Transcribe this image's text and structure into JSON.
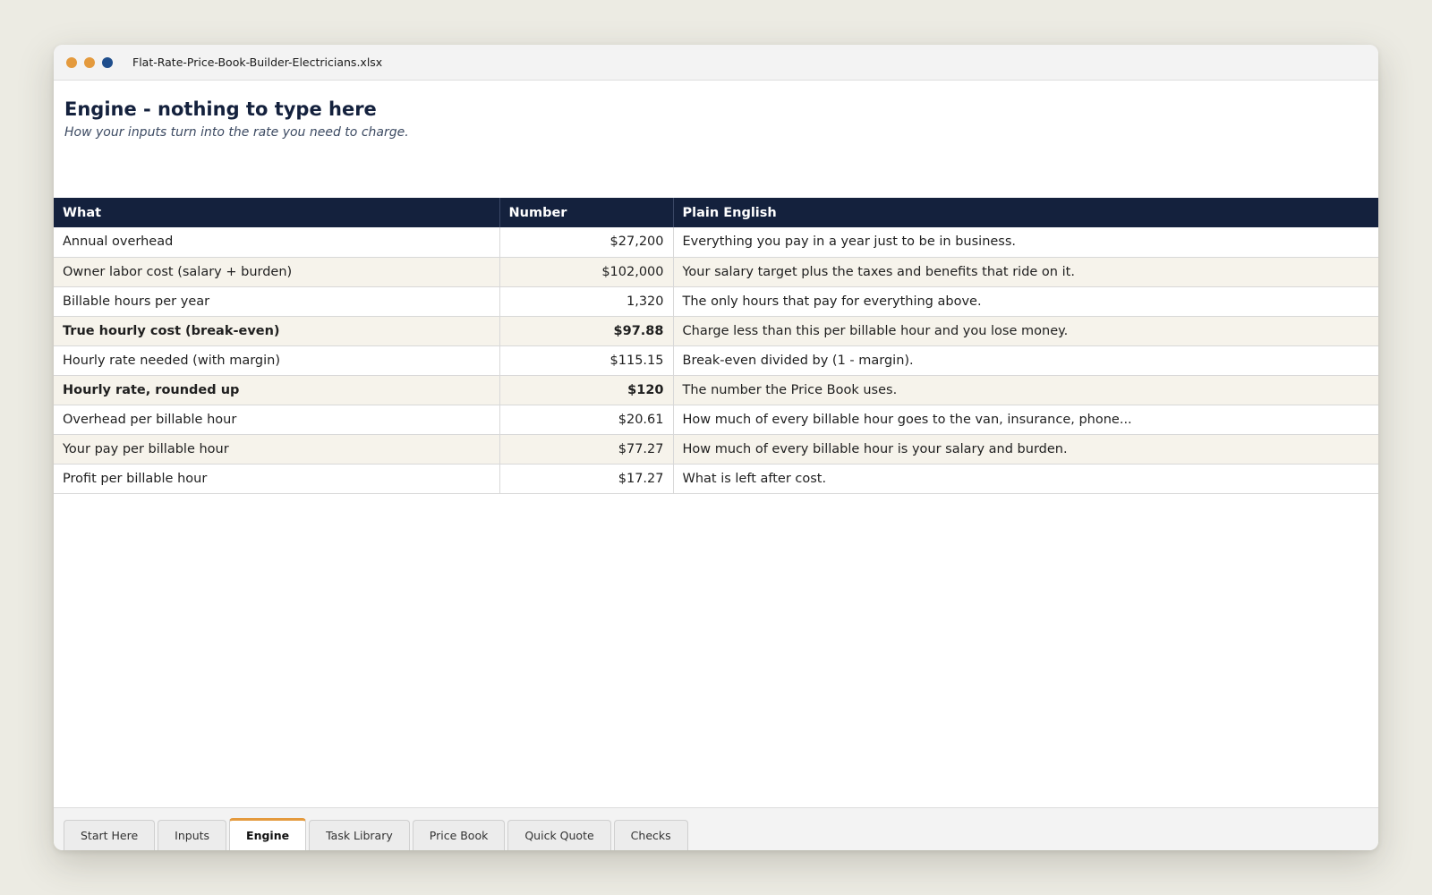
{
  "window": {
    "filename": "Flat-Rate-Price-Book-Builder-Electricians.xlsx",
    "controls": [
      {
        "name": "close",
        "color": "#e49a3d"
      },
      {
        "name": "minimize",
        "color": "#e49a3d"
      },
      {
        "name": "maximize",
        "color": "#1f4e8c"
      }
    ]
  },
  "sheet": {
    "title": "Engine - nothing to type here",
    "subtitle": "How your inputs turn into the rate you need to charge.",
    "columns": [
      "What",
      "Number",
      "Plain English"
    ],
    "rows": [
      {
        "what": "Annual overhead",
        "number": "$27,200",
        "plain": "Everything you pay in a year just to be in business.",
        "bold": false
      },
      {
        "what": "Owner labor cost (salary + burden)",
        "number": "$102,000",
        "plain": "Your salary target plus the taxes and benefits that ride on it.",
        "bold": false
      },
      {
        "what": "Billable hours per year",
        "number": "1,320",
        "plain": "The only hours that pay for everything above.",
        "bold": false
      },
      {
        "what": "True hourly cost (break-even)",
        "number": "$97.88",
        "plain": "Charge less than this per billable hour and you lose money.",
        "bold": true
      },
      {
        "what": "Hourly rate needed (with margin)",
        "number": "$115.15",
        "plain": "Break-even divided by (1 - margin).",
        "bold": false
      },
      {
        "what": "Hourly rate, rounded up",
        "number": "$120",
        "plain": "The number the Price Book uses.",
        "bold": true
      },
      {
        "what": "Overhead per billable hour",
        "number": "$20.61",
        "plain": "How much of every billable hour goes to the van, insurance, phone...",
        "bold": false
      },
      {
        "what": "Your pay per billable hour",
        "number": "$77.27",
        "plain": "How much of every billable hour is your salary and burden.",
        "bold": false
      },
      {
        "what": "Profit per billable hour",
        "number": "$17.27",
        "plain": "What is left after cost.",
        "bold": false
      }
    ]
  },
  "tabs": [
    {
      "label": "Start Here",
      "active": false
    },
    {
      "label": "Inputs",
      "active": false
    },
    {
      "label": "Engine",
      "active": true
    },
    {
      "label": "Task Library",
      "active": false
    },
    {
      "label": "Price Book",
      "active": false
    },
    {
      "label": "Quick Quote",
      "active": false
    },
    {
      "label": "Checks",
      "active": false
    }
  ]
}
